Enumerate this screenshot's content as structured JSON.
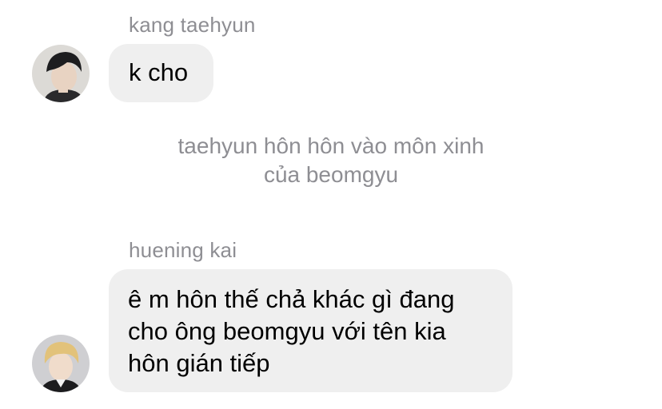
{
  "messages": [
    {
      "sender": "kang taehyun",
      "text": "k cho",
      "avatar_icon": "profile-photo-dark-hair"
    },
    {
      "sender": "huening kai",
      "text": "ê m hôn thế chả khác gì đang\ncho ông beomgyu với tên kia\nhôn gián tiếp",
      "avatar_icon": "profile-photo-blonde-hair"
    }
  ],
  "system_message": {
    "text": "taehyun hôn hôn vào môn xinh\ncủa beomgyu"
  },
  "colors": {
    "bubble_background": "#efefef",
    "secondary_text": "#8e8e93",
    "page_background": "#ffffff"
  }
}
